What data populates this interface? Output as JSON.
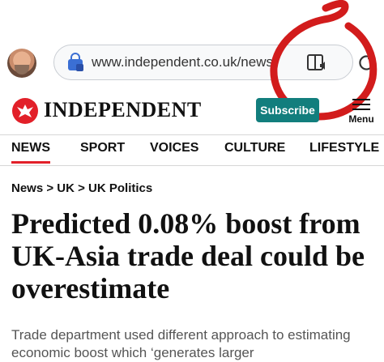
{
  "browser": {
    "url": "www.independent.co.uk/news/uk/p"
  },
  "site": {
    "masthead": "INDEPENDENT",
    "subscribe_label": "Subscribe",
    "menu_label": "Menu",
    "brand_red": "#e22029",
    "subscribe_color": "#127e7d"
  },
  "nav": {
    "items": [
      {
        "label": "NEWS",
        "active": true
      },
      {
        "label": "SPORT"
      },
      {
        "label": "VOICES"
      },
      {
        "label": "CULTURE"
      },
      {
        "label": "LIFESTYLE"
      }
    ]
  },
  "article": {
    "breadcrumb": "News > UK > UK Politics",
    "headline": "Predicted 0.08% boost from UK-Asia trade deal could be overestimate",
    "standfirst": "Trade department used different approach to estimating economic boost which ‘generates larger"
  },
  "annotation": {
    "color": "#d21c1c",
    "shape": "hand-drawn circle"
  },
  "icons": [
    "avatar",
    "bag-lock-icon",
    "reader-mode-icon",
    "refresh-icon",
    "eagle-logo-icon",
    "menu-icon"
  ]
}
